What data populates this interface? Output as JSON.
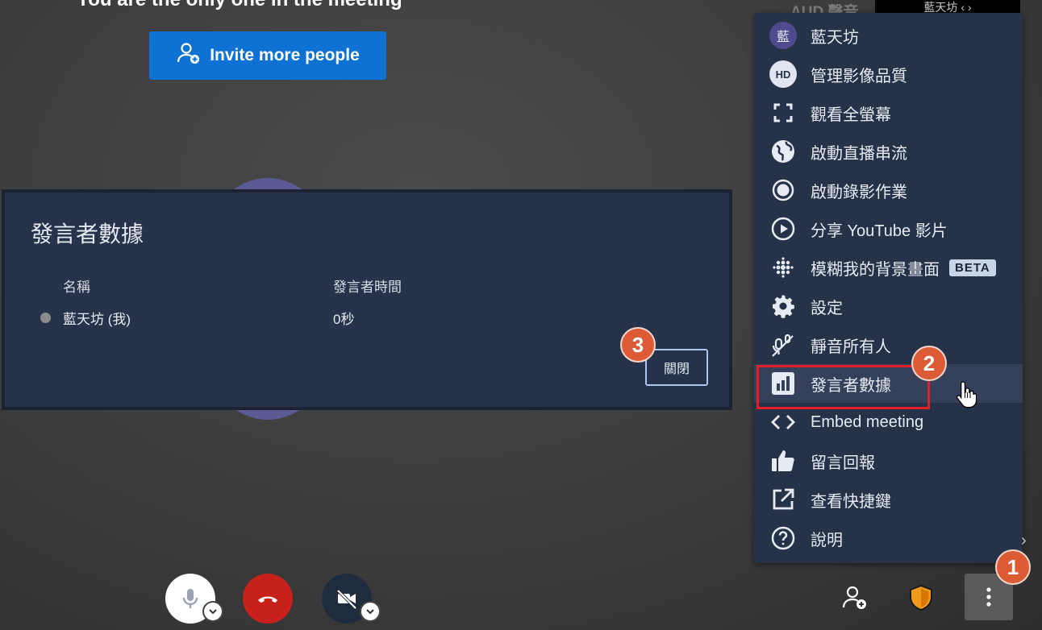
{
  "meeting": {
    "banner_text": "You are the only one in the meeting",
    "invite_label": "Invite more people",
    "participant_label_ghost": "AUD 聲音",
    "thumbnail_text": "藍天坊 ‹ ›"
  },
  "speaker_stats": {
    "title": "發言者數據",
    "col_name": "名稱",
    "col_time": "發言者時間",
    "rows": [
      {
        "name": "藍天坊 (我)",
        "time": "0秒"
      }
    ],
    "close_label": "關閉"
  },
  "menu": {
    "items": [
      {
        "label": "藍天坊",
        "icon": "avatar",
        "avatar_text": "藍"
      },
      {
        "label": "管理影像品質",
        "icon": "hd-icon",
        "badge_text": "HD"
      },
      {
        "label": "觀看全螢幕",
        "icon": "fullscreen-icon"
      },
      {
        "label": "啟動直播串流",
        "icon": "globe-icon"
      },
      {
        "label": "啟動錄影作業",
        "icon": "record-icon"
      },
      {
        "label": "分享 YouTube 影片",
        "icon": "play-circle-icon"
      },
      {
        "label": "模糊我的背景畫面",
        "icon": "blur-icon",
        "badge": "BETA"
      },
      {
        "label": "設定",
        "icon": "gear-icon"
      },
      {
        "label": "靜音所有人",
        "icon": "mute-all-icon"
      },
      {
        "label": "發言者數據",
        "icon": "bar-chart-icon",
        "highlighted": true
      },
      {
        "label": "Embed meeting",
        "icon": "code-icon"
      },
      {
        "label": "留言回報",
        "icon": "thumbs-up-icon"
      },
      {
        "label": "查看快捷鍵",
        "icon": "external-link-icon"
      },
      {
        "label": "說明",
        "icon": "help-icon"
      }
    ]
  },
  "annotations": {
    "step1": "1",
    "step2": "2",
    "step3": "3"
  },
  "colors": {
    "accent_blue": "#0e72d4",
    "menu_bg": "#263248",
    "hangup_red": "#c8201b",
    "annotation_orange": "#dc5a34",
    "highlight_red": "#e41e26",
    "shield_orange": "#f29a1c"
  }
}
